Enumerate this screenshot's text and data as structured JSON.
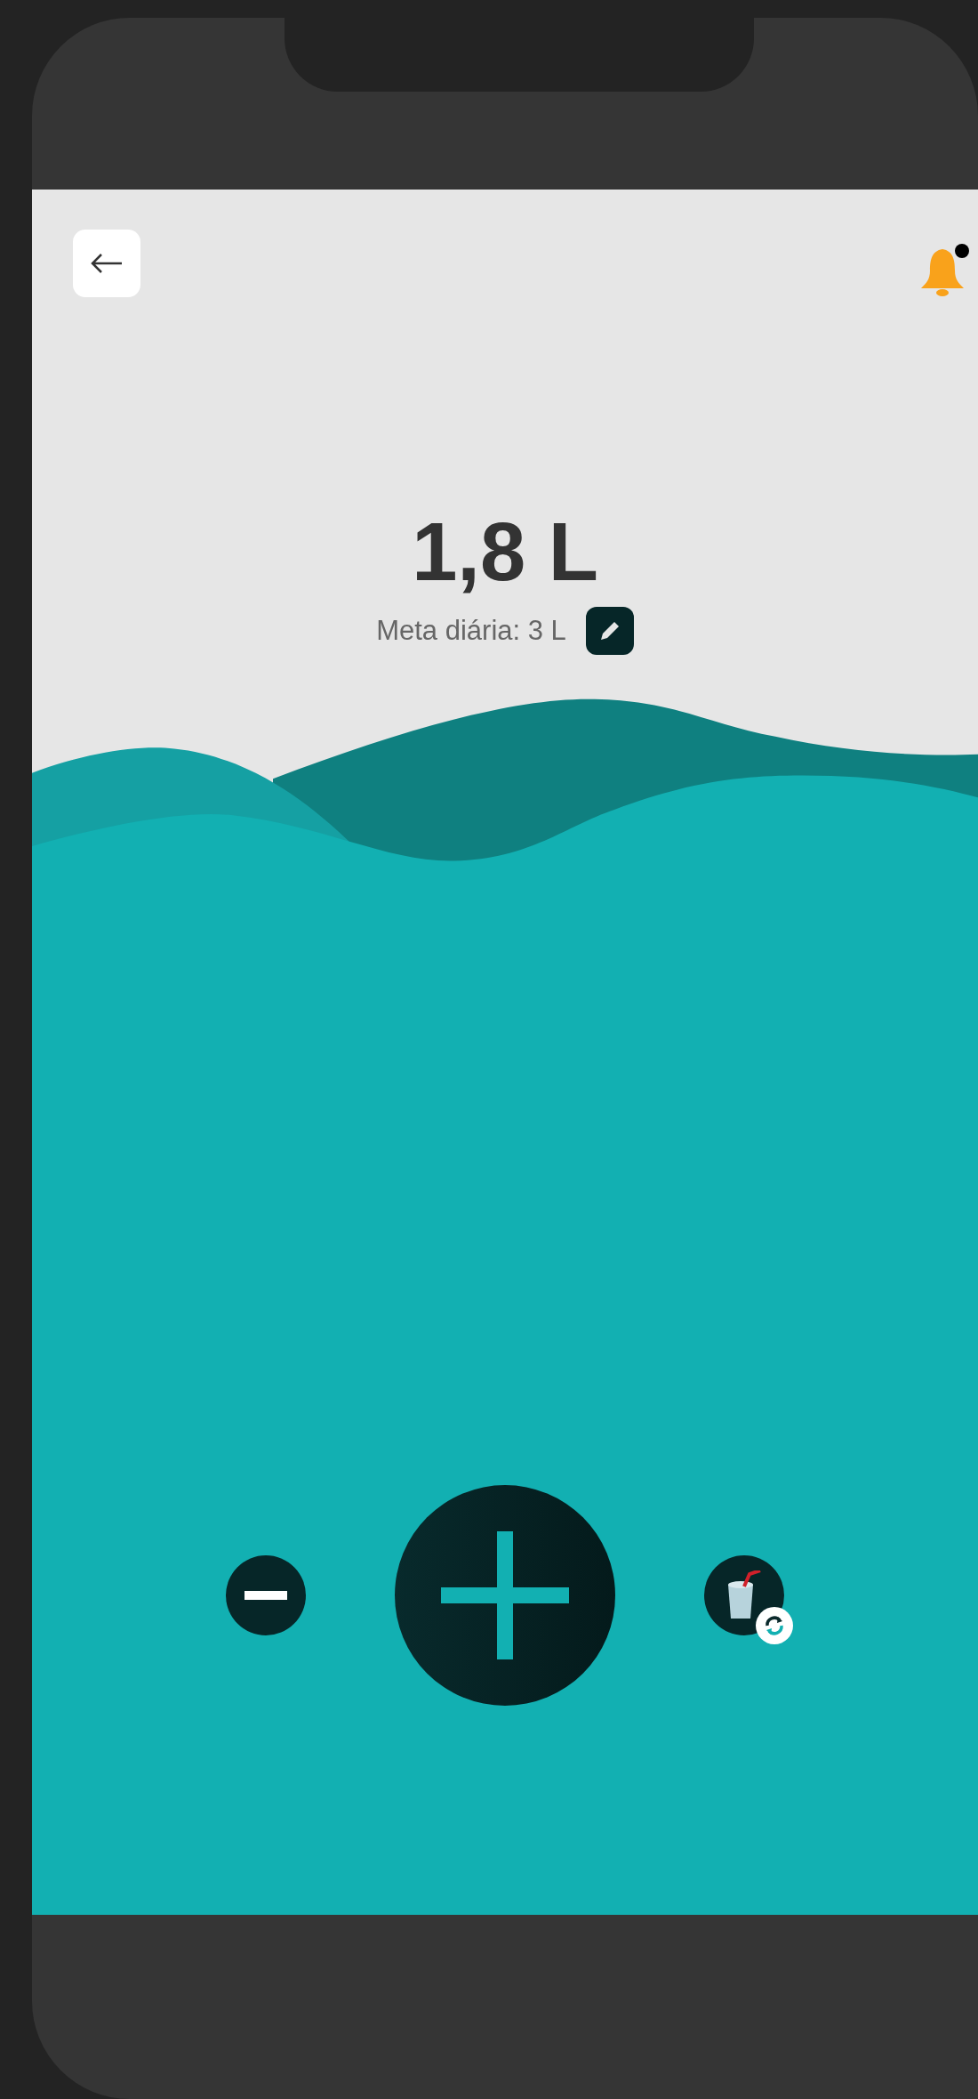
{
  "header": {
    "notification_badge": true
  },
  "intake": {
    "amount": "1,8 L",
    "goal": "Meta diária: 3 L"
  },
  "controls": [
    {
      "kind": "minus"
    },
    {
      "kind": "plus"
    },
    {
      "kind": "cup"
    }
  ]
}
